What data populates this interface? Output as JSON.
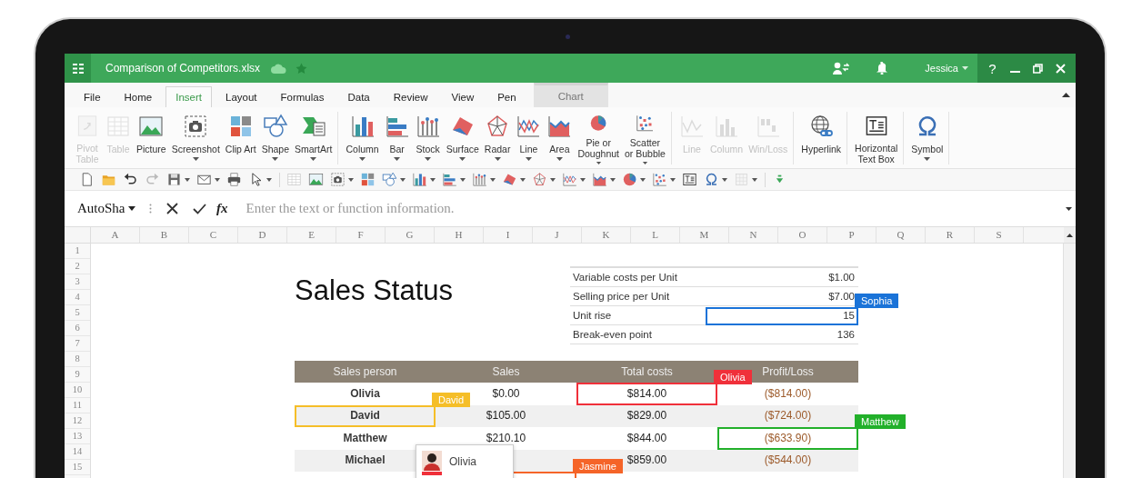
{
  "window": {
    "title": "Comparison of Competitors.xlsx",
    "user": "Jessica",
    "help": "?"
  },
  "tabs": [
    {
      "label": "File",
      "selected": false,
      "kind": "tab"
    },
    {
      "label": "Home",
      "selected": false,
      "kind": "tab"
    },
    {
      "label": "Insert",
      "selected": true,
      "kind": "tab"
    },
    {
      "label": "Layout",
      "selected": false,
      "kind": "tab"
    },
    {
      "label": "Formulas",
      "selected": false,
      "kind": "tab"
    },
    {
      "label": "Data",
      "selected": false,
      "kind": "tab"
    },
    {
      "label": "Review",
      "selected": false,
      "kind": "tab"
    },
    {
      "label": "View",
      "selected": false,
      "kind": "tab"
    },
    {
      "label": "Pen",
      "selected": false,
      "kind": "tab"
    },
    {
      "label": "Chart",
      "selected": false,
      "kind": "context"
    }
  ],
  "ribbon": {
    "groups": [
      {
        "items": [
          {
            "label": "Pivot\nTable",
            "disabled": true,
            "dropdown": false
          },
          {
            "label": "Table",
            "disabled": true,
            "dropdown": false
          },
          {
            "label": "Picture",
            "disabled": false,
            "dropdown": false
          },
          {
            "label": "Screenshot",
            "disabled": false,
            "dropdown": true
          },
          {
            "label": "Clip Art",
            "disabled": false,
            "dropdown": false
          },
          {
            "label": "Shape",
            "disabled": false,
            "dropdown": true
          },
          {
            "label": "SmartArt",
            "disabled": false,
            "dropdown": true
          }
        ]
      },
      {
        "items": [
          {
            "label": "Column",
            "disabled": false,
            "dropdown": true
          },
          {
            "label": "Bar",
            "disabled": false,
            "dropdown": true
          },
          {
            "label": "Stock",
            "disabled": false,
            "dropdown": true
          },
          {
            "label": "Surface",
            "disabled": false,
            "dropdown": true
          },
          {
            "label": "Radar",
            "disabled": false,
            "dropdown": true
          },
          {
            "label": "Line",
            "disabled": false,
            "dropdown": true
          },
          {
            "label": "Area",
            "disabled": false,
            "dropdown": true
          },
          {
            "label": "Pie or\nDoughnut",
            "disabled": false,
            "dropdown": true
          },
          {
            "label": "Scatter\nor Bubble",
            "disabled": false,
            "dropdown": true
          }
        ]
      },
      {
        "items": [
          {
            "label": "Line",
            "disabled": true,
            "dropdown": false
          },
          {
            "label": "Column",
            "disabled": true,
            "dropdown": false
          },
          {
            "label": "Win/Loss",
            "disabled": true,
            "dropdown": false
          }
        ]
      },
      {
        "items": [
          {
            "label": "Hyperlink",
            "disabled": false,
            "dropdown": false
          }
        ]
      },
      {
        "items": [
          {
            "label": "Horizontal\nText Box",
            "disabled": false,
            "dropdown": false
          }
        ]
      },
      {
        "items": [
          {
            "label": "Symbol",
            "disabled": false,
            "dropdown": true
          }
        ]
      }
    ]
  },
  "formula_bar": {
    "name_box": "AutoSha",
    "function_label": "fx",
    "placeholder": "Enter the text or function information."
  },
  "sheet": {
    "columns": [
      "A",
      "B",
      "C",
      "D",
      "E",
      "F",
      "G",
      "H",
      "I",
      "J",
      "K",
      "L",
      "M",
      "N",
      "O",
      "P",
      "Q",
      "R",
      "S"
    ],
    "rows": [
      "1",
      "2",
      "3",
      "4",
      "5",
      "6",
      "7",
      "8",
      "9",
      "10",
      "11",
      "12",
      "13",
      "14",
      "15"
    ]
  },
  "title": "Sales Status",
  "summary": [
    {
      "label": "Variable costs per Unit",
      "value": "$1.00"
    },
    {
      "label": "Selling price per Unit",
      "value": "$7.00"
    },
    {
      "label": "Unit rise",
      "value": "15",
      "editor": {
        "name": "Sophia",
        "color": "#1a73d8"
      }
    },
    {
      "label": "Break-even point",
      "value": "136"
    }
  ],
  "table": {
    "columns": [
      "Sales person",
      "Sales",
      "Total costs",
      "Profit/Loss"
    ],
    "rows": [
      {
        "cells": [
          {
            "text": "Olivia"
          },
          {
            "text": "$0.00"
          },
          {
            "text": "$814.00",
            "editor": {
              "name": "Olivia",
              "color": "#f0303a"
            }
          },
          {
            "text": "($814.00)"
          }
        ]
      },
      {
        "cells": [
          {
            "text": "David",
            "editor": {
              "name": "David",
              "color": "#f5be28"
            }
          },
          {
            "text": "$105.00"
          },
          {
            "text": "$829.00"
          },
          {
            "text": "($724.00)"
          }
        ]
      },
      {
        "cells": [
          {
            "text": "Matthew"
          },
          {
            "text": "$210.10"
          },
          {
            "text": "$844.00"
          },
          {
            "text": "($633.90)",
            "editor": {
              "name": "Matthew",
              "color": "#22b02a"
            }
          }
        ]
      },
      {
        "cells": [
          {
            "text": "Michael"
          },
          {},
          {
            "text": "$859.00"
          },
          {
            "text": "($544.00)"
          }
        ]
      },
      {
        "cells": [
          {},
          {
            "editor": {
              "name": "Jasmine",
              "color": "#f56428"
            }
          },
          {},
          {}
        ]
      }
    ]
  },
  "presence": [
    {
      "name": "Olivia",
      "color": "#f0303a"
    }
  ]
}
